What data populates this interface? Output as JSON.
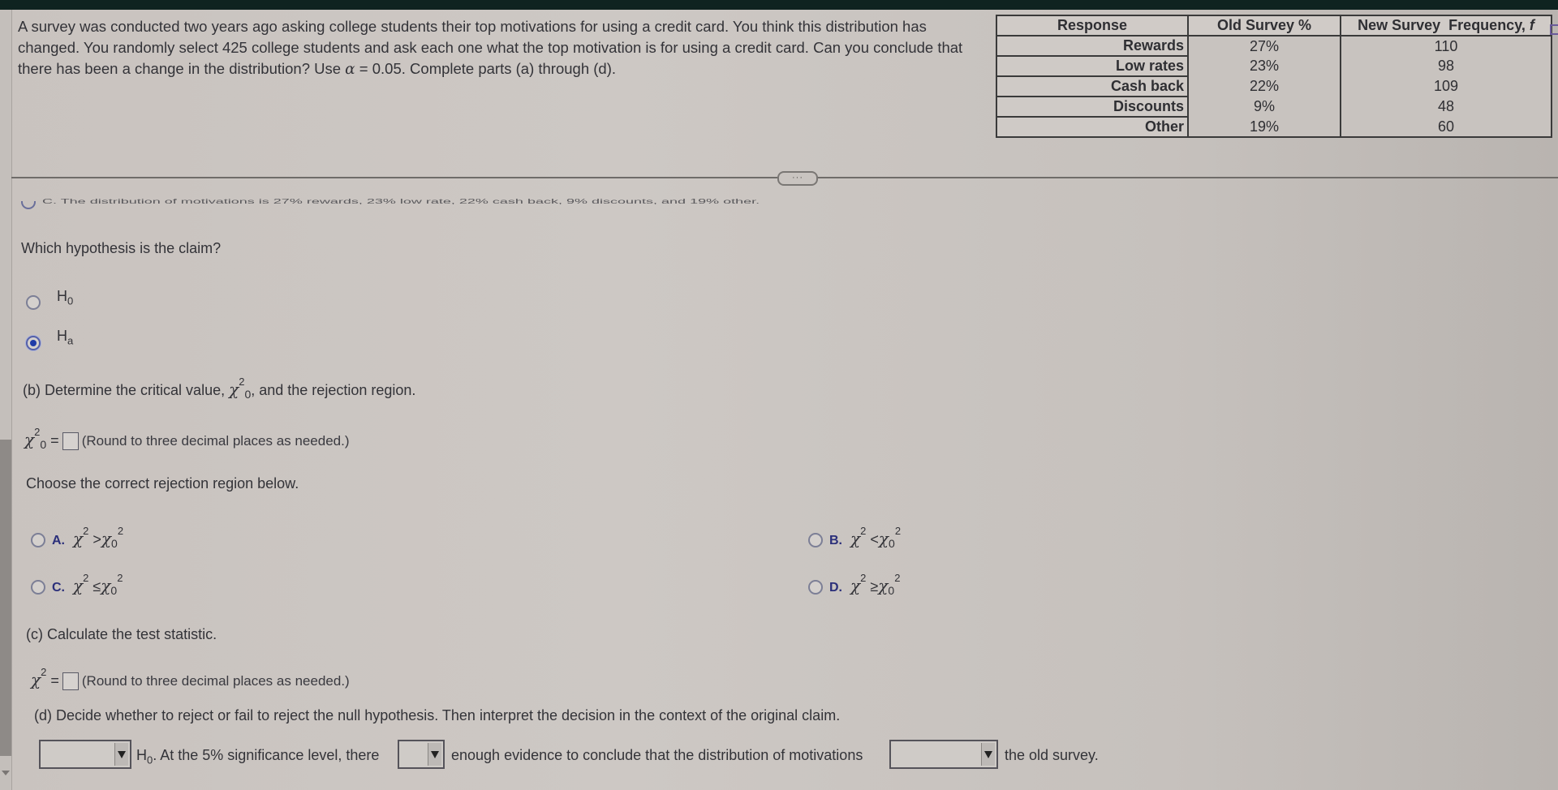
{
  "problem": {
    "intro_line1": "A survey was conducted two years ago asking college students their top motivations for using a credit card. You think this distribution has",
    "intro_line2": "changed. You randomly select 425 college students and ask each one what the top motivation is for using a credit card. Can you conclude that",
    "intro_line3_pre": "there has been a change in the distribution? Use ",
    "intro_alpha": "α",
    "intro_line3_post": " = 0.05. Complete parts (a) through (d)."
  },
  "table": {
    "headers": [
      "Response",
      "Old Survey %",
      "New Survey  Frequency, f"
    ],
    "rows": [
      {
        "response": "Rewards",
        "old": "27%",
        "new": "110"
      },
      {
        "response": "Low rates",
        "old": "23%",
        "new": "98"
      },
      {
        "response": "Cash back",
        "old": "22%",
        "new": "109"
      },
      {
        "response": "Discounts",
        "old": "9%",
        "new": "48"
      },
      {
        "response": "Other",
        "old": "19%",
        "new": "60"
      }
    ]
  },
  "more_button": "···",
  "cut_option": "C.   The distribution of motivations is 27% rewards, 23% low rate, 22% cash back, 9% discounts, and 19% other.",
  "part_a": {
    "question": "Which hypothesis is the claim?",
    "options": [
      {
        "label": "H",
        "sub": "0",
        "selected": false
      },
      {
        "label": "H",
        "sub": "a",
        "selected": true
      }
    ]
  },
  "part_b": {
    "prompt_pre": "(b) Determine the critical value, ",
    "prompt_post": ", and the rejection region.",
    "chi": "χ",
    "sup": "2",
    "sub": "0",
    "equals": "=",
    "round_note": "(Round to three decimal places as needed.)",
    "choose": "Choose the correct rejection region below.",
    "options": [
      {
        "letter": "A.",
        "op": ">"
      },
      {
        "letter": "B.",
        "op": "<"
      },
      {
        "letter": "C.",
        "op": "≤"
      },
      {
        "letter": "D.",
        "op": "≥"
      }
    ]
  },
  "part_c": {
    "prompt": "(c) Calculate the test statistic.",
    "equals": "=",
    "round_note": "(Round to three decimal places as needed.)"
  },
  "part_d": {
    "prompt": "(d) Decide whether to reject or fail to reject the null hypothesis. Then interpret the decision in the context of the original claim.",
    "h0": "H",
    "h0_sub": "0",
    "text1": ". At the 5% significance level, there",
    "text2": "enough evidence to conclude that the distribution of motivations",
    "text3": "the old survey.",
    "select1_value": "",
    "select2_value": "",
    "select3_value": ""
  }
}
